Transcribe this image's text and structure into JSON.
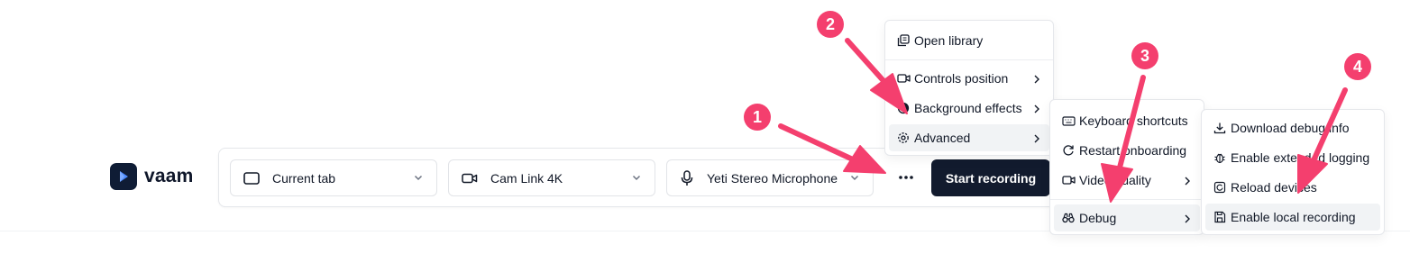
{
  "app": {
    "name": "vaam"
  },
  "toolbar": {
    "source_select": "Current tab",
    "camera_select": "Cam Link 4K",
    "mic_select": "Yeti Stereo Microphone",
    "start_label": "Start recording"
  },
  "menu_main": {
    "items": [
      {
        "label": "Open library",
        "icon": "library-icon"
      },
      {
        "label": "Controls position",
        "icon": "video-icon"
      },
      {
        "label": "Background effects",
        "icon": "contrast-icon"
      },
      {
        "label": "Advanced",
        "icon": "settings-icon"
      }
    ]
  },
  "menu_advanced": {
    "items": [
      {
        "label": "Keyboard shortcuts",
        "icon": "keyboard-icon"
      },
      {
        "label": "Restart onboarding",
        "icon": "restart-icon"
      },
      {
        "label": "Video quality",
        "icon": "video-icon"
      },
      {
        "label": "Debug",
        "icon": "binoculars-icon"
      }
    ]
  },
  "menu_debug": {
    "items": [
      {
        "label": "Download debug info",
        "icon": "download-icon"
      },
      {
        "label": "Enable extended logging",
        "icon": "bug-icon"
      },
      {
        "label": "Reload devices",
        "icon": "reload-icon"
      },
      {
        "label": "Enable local recording",
        "icon": "save-icon"
      }
    ]
  },
  "annotations": [
    "1",
    "2",
    "3",
    "4"
  ],
  "colors": {
    "accent": "#f43f6e",
    "primary": "#121b2e",
    "logo_bg": "#0f1c35"
  }
}
